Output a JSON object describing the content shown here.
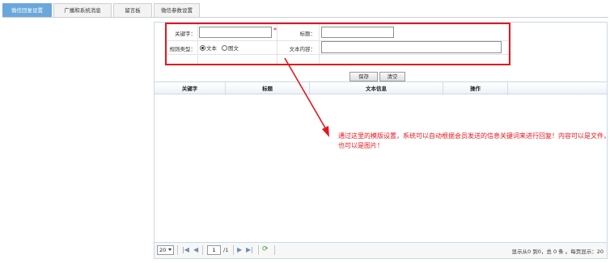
{
  "tabs": [
    "微信回复设置",
    "广播和系统消息",
    "留言板",
    "微信参数设置"
  ],
  "form": {
    "keyword_label": "关键字：",
    "keyword_value": "",
    "required_mark": "*",
    "title_label": "标题：",
    "title_value": "",
    "rule_type_label": "规则类型：",
    "rule_text_option": "文本",
    "rule_image_option": "图文",
    "rule_selected": "文本",
    "content_label": "文本内容：",
    "content_value": ""
  },
  "buttons": {
    "save": "保存",
    "clear": "清空"
  },
  "table": {
    "columns": [
      "关键字",
      "标题",
      "文本信息",
      "操作"
    ],
    "rows": []
  },
  "annotation": "通过这里的模版设置，系统可以自动根据会员发送的信息关键词来进行回复！内容可以是文件，也可以是图片！",
  "pager": {
    "page_size": "20",
    "current_page": "1",
    "total_pages": "/1",
    "summary": "显示从0 到0，总 0 条 。每页显示：20"
  },
  "colors": {
    "active_tab": "#6aa7dc",
    "annotation_red": "#e8141c",
    "panel_border": "#c9d9ea"
  },
  "icons": [
    "first-page-icon",
    "prev-page-icon",
    "next-page-icon",
    "last-page-icon",
    "refresh-icon",
    "dropdown-caret-icon"
  ]
}
